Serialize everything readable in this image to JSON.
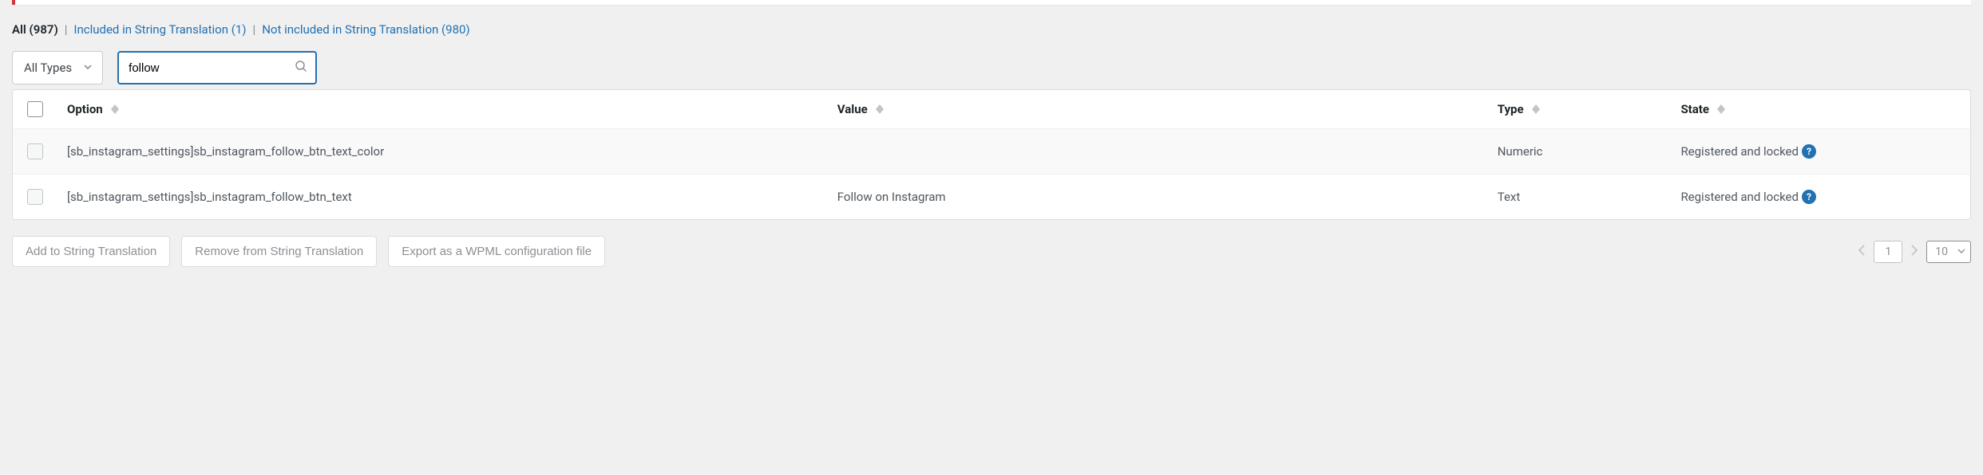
{
  "filters": {
    "all": "All (987)",
    "included": "Included in String Translation (1)",
    "not_included": "Not included in String Translation (980)"
  },
  "controls": {
    "type_select": "All Types",
    "search_value": "follow"
  },
  "table": {
    "headers": {
      "option": "Option",
      "value": "Value",
      "type": "Type",
      "state": "State"
    },
    "rows": [
      {
        "option": "[sb_instagram_settings]sb_instagram_follow_btn_text_color",
        "value": "",
        "type": "Numeric",
        "state": "Registered and locked"
      },
      {
        "option": "[sb_instagram_settings]sb_instagram_follow_btn_text",
        "value": "Follow on Instagram",
        "type": "Text",
        "state": "Registered and locked"
      }
    ]
  },
  "footer": {
    "add_btn": "Add to String Translation",
    "remove_btn": "Remove from String Translation",
    "export_btn": "Export as a WPML configuration file",
    "page": "1",
    "page_size": "10"
  }
}
